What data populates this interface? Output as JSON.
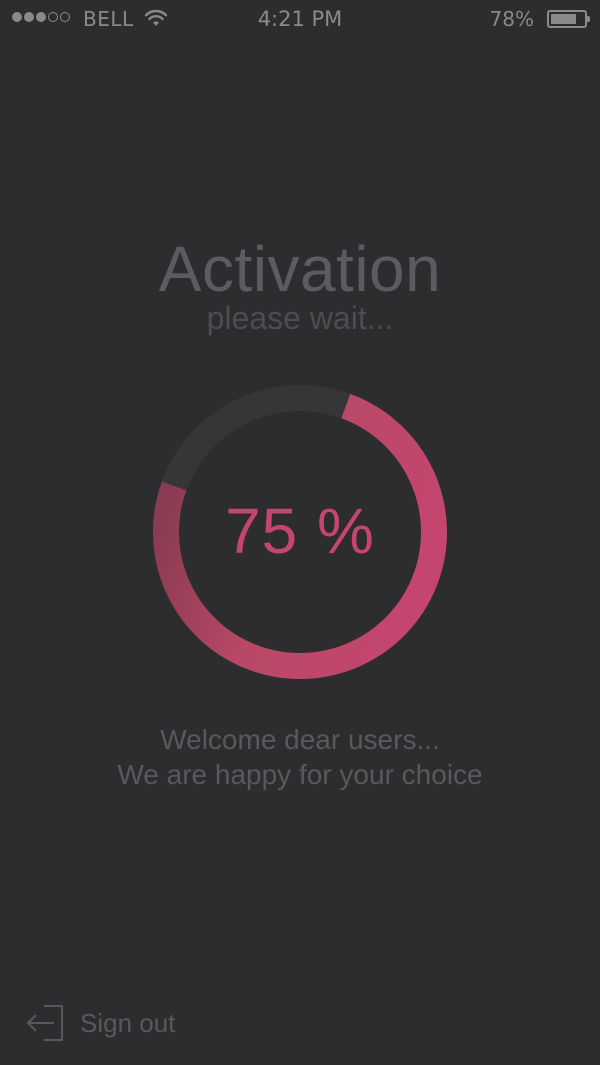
{
  "status_bar": {
    "carrier": "BELL",
    "time": "4:21 PM",
    "battery_percent": "78%",
    "battery_level": 0.78,
    "signal_bars_filled": 3,
    "signal_bars_total": 5,
    "icons": [
      "signal-dots-icon",
      "wifi-icon",
      "battery-icon"
    ]
  },
  "activation": {
    "title": "Activation",
    "subtitle": "please wait...",
    "progress": 0.75,
    "progress_label": "75 %"
  },
  "welcome": {
    "line1": "Welcome dear users...",
    "line2": "We are happy for your choice"
  },
  "footer": {
    "signout_label": "Sign out",
    "signout_icon": "sign-out-icon"
  },
  "colors": {
    "background": "#2d2d2f",
    "accent": "#c4466f",
    "ring_track": "#363638",
    "text_muted": "#59595d"
  }
}
